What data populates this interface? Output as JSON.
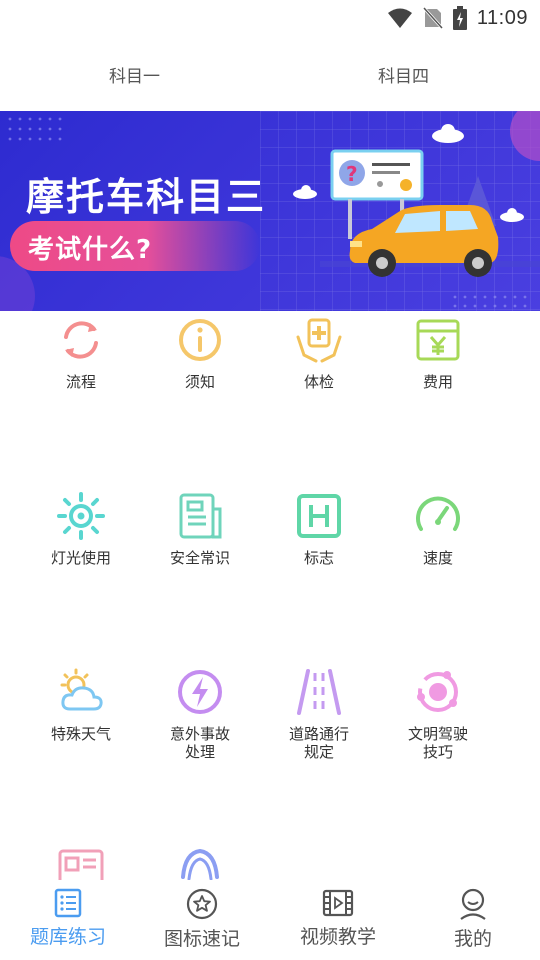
{
  "status_bar": {
    "time": "11:09"
  },
  "top_tabs": [
    "科目一",
    "科目四"
  ],
  "banner": {
    "title": "摩托车科目三",
    "subtitle": "考试什么?"
  },
  "grid": [
    {
      "label": "流程",
      "icon": "refresh-cycle-icon",
      "color": "#f48f8f"
    },
    {
      "label": "须知",
      "icon": "info-icon",
      "color": "#f5c76a"
    },
    {
      "label": "体检",
      "icon": "medical-hands-icon",
      "color": "#f2c25a"
    },
    {
      "label": "费用",
      "icon": "yen-wallet-icon",
      "color": "#a7d957"
    },
    {
      "label": "灯光使用",
      "icon": "sun-light-icon",
      "color": "#59d6d0"
    },
    {
      "label": "安全常识",
      "icon": "document-icon",
      "color": "#6fd4bb"
    },
    {
      "label": "标志",
      "icon": "h-sign-icon",
      "color": "#5fd6a7"
    },
    {
      "label": "速度",
      "icon": "speedometer-icon",
      "color": "#7bd77a"
    },
    {
      "label": "特殊天气",
      "icon": "weather-icon",
      "color": "#7ec7f2"
    },
    {
      "label": "意外事故\n处理",
      "icon": "lightning-icon",
      "color": "#c48df0"
    },
    {
      "label": "道路通行\n规定",
      "icon": "road-icon",
      "color": "#c49af0"
    },
    {
      "label": "文明驾驶\n技巧",
      "icon": "orbit-icon",
      "color": "#f09ae2"
    },
    {
      "label": "",
      "icon": "id-card-icon",
      "color": "#f1a0b8"
    },
    {
      "label": "",
      "icon": "arch-icon",
      "color": "#8b9ef2"
    }
  ],
  "bottom_nav": [
    {
      "label": "题库练习",
      "active": true
    },
    {
      "label": "图标速记",
      "active": false
    },
    {
      "label": "视频教学",
      "active": false
    },
    {
      "label": "我的",
      "active": false
    }
  ],
  "colors": {
    "accent": "#4b9cf0",
    "banner_bg": "#3b34d8",
    "banner_pill": "#ee4a86"
  }
}
